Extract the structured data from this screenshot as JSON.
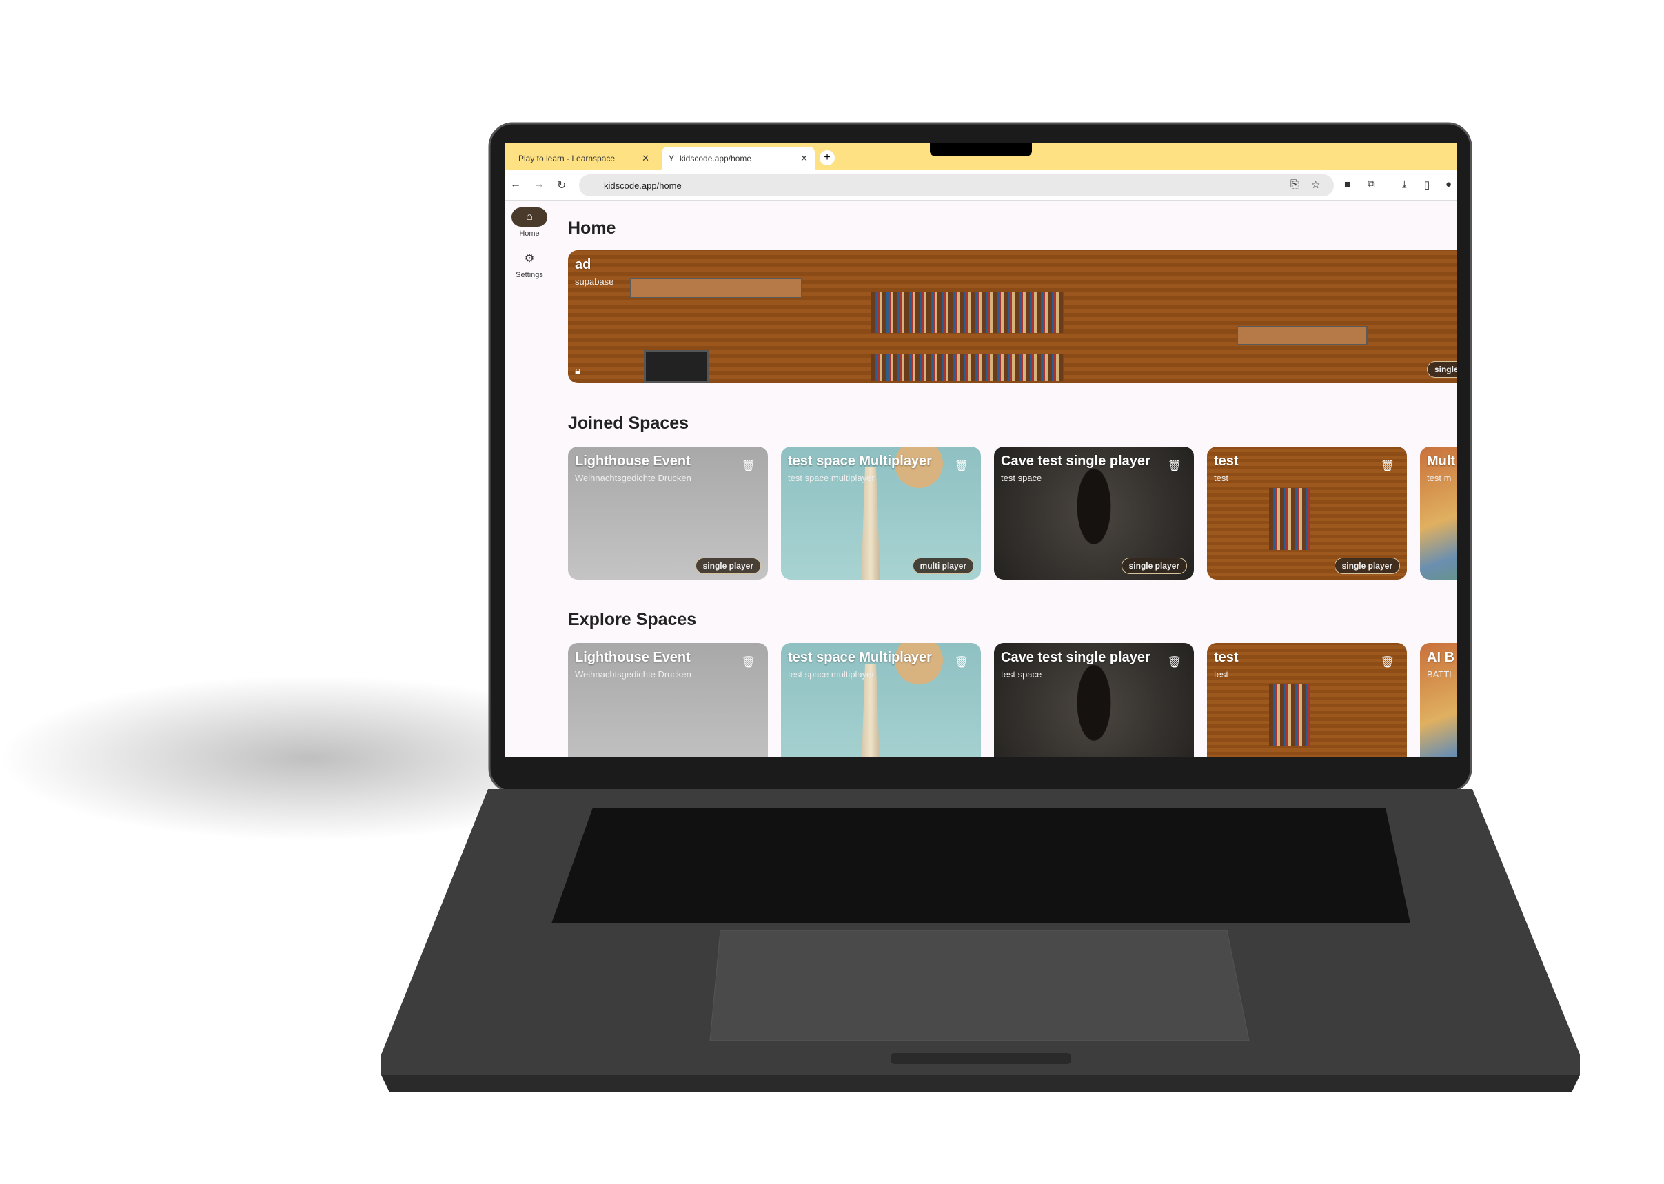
{
  "browser": {
    "tabs": [
      {
        "title": "Play to learn - Learnspace",
        "active": false
      },
      {
        "title": "kidscode.app/home",
        "active": true
      }
    ],
    "url": "kidscode.app/home",
    "accent": "#fde183"
  },
  "sidebar": {
    "items": [
      {
        "label": "Home",
        "icon": "home-icon",
        "active": true
      },
      {
        "label": "Settings",
        "icon": "gear-icon",
        "active": false
      }
    ],
    "fab_icon": "pencil-icon"
  },
  "home": {
    "title": "Home",
    "banner": {
      "title": "ad",
      "subtitle": "supabase",
      "badge": "single play",
      "locked": true
    }
  },
  "joined": {
    "title": "Joined Spaces",
    "cards": [
      {
        "title": "Lighthouse Event",
        "subtitle": "Weihnachtsgedichte Drucken",
        "badge": "single player"
      },
      {
        "title": "test space Multiplayer",
        "subtitle": "test space multiplayer",
        "badge": "multi player"
      },
      {
        "title": "Cave test single player",
        "subtitle": "test space",
        "badge": "single player"
      },
      {
        "title": "test",
        "subtitle": "test",
        "badge": "single player"
      },
      {
        "title": "Mult",
        "subtitle": "test m",
        "badge": ""
      }
    ]
  },
  "explore": {
    "title": "Explore Spaces",
    "cards": [
      {
        "title": "Lighthouse Event",
        "subtitle": "Weihnachtsgedichte Drucken"
      },
      {
        "title": "test space Multiplayer",
        "subtitle": "test space multiplayer"
      },
      {
        "title": "Cave test single player",
        "subtitle": "test space"
      },
      {
        "title": "test",
        "subtitle": "test"
      },
      {
        "title": "AI B",
        "subtitle": "BATTL"
      }
    ]
  }
}
